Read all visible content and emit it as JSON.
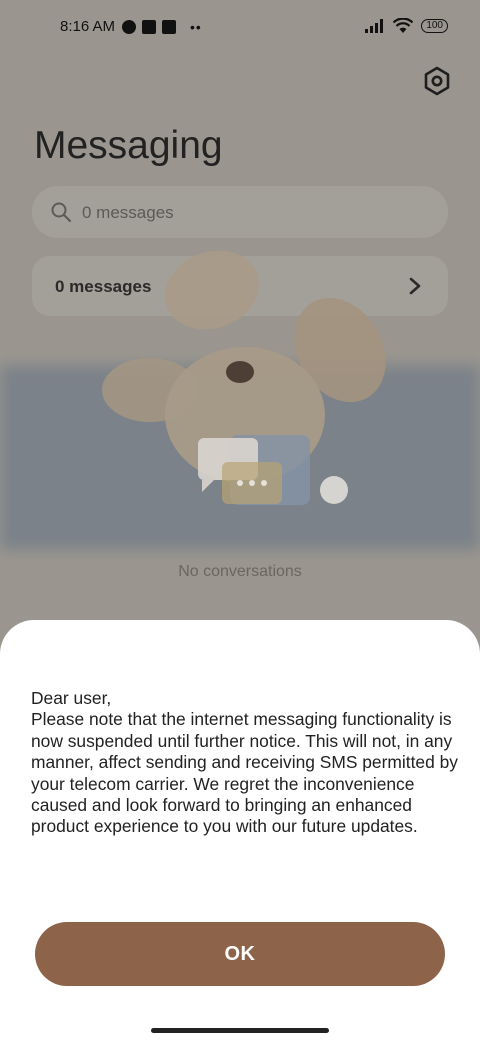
{
  "status_bar": {
    "time": "8:16 AM",
    "battery": "100",
    "icons": [
      "app-notification-icon",
      "app-notification-icon",
      "upload-icon",
      "more-dots-icon",
      "signal-icon",
      "wifi-icon",
      "battery-icon"
    ]
  },
  "header": {
    "title": "Messaging",
    "settings_icon": "settings-icon"
  },
  "search": {
    "placeholder": "0 messages"
  },
  "messages_card": {
    "label": "0 messages"
  },
  "empty_state": {
    "text": "No conversations"
  },
  "dialog": {
    "greeting": "Dear user,",
    "message": "Please note that the internet messaging functionality is now suspended until further notice. This will not, in any manner, affect sending and receiving SMS permitted by your telecom carrier. We regret the inconvenience caused and look forward to bringing an enhanced product experience to you with our future updates.",
    "ok_label": "OK"
  },
  "colors": {
    "scrim": "#9a968f",
    "button": "#8d634a",
    "sheet": "#ffffff"
  }
}
